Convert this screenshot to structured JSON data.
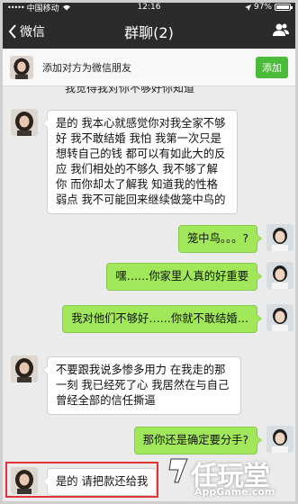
{
  "status_bar": {
    "carrier": "中国移动",
    "time": "12:16",
    "battery": "97%",
    "battery_level": 0.97
  },
  "nav": {
    "back_label": "微信",
    "title": "群聊(2)",
    "right_icon": "person-icon"
  },
  "banner": {
    "text": "添加对方为微信朋友",
    "button": "添加"
  },
  "partial_line": "我觉得我对你不够好你知道",
  "messages": [
    {
      "side": "left",
      "text": "是的 我本心就感觉你对我全家不够好 我不敢结婚 我怕 我第一次只是想转自己的钱 都可以有如此大的反应 我们相处的不够久 我不够了解你  而你却太了解我 知道我的性格弱点 我不可能回来继续做笼中鸟的"
    },
    {
      "side": "right",
      "text": "笼中鸟。。。?"
    },
    {
      "side": "right",
      "text": "嘿……你家里人真的好重要"
    },
    {
      "side": "right",
      "text": "我对他们不够好……你就不敢结婚…"
    },
    {
      "side": "left",
      "text": "不要跟我说多惨多用力 在我走的那一刻 我已经死了心  我居然在与自己曾经全部的信任撕逼"
    },
    {
      "side": "right",
      "text": "那你还是确定要分手?"
    },
    {
      "side": "left",
      "text": "是的  请把款还给我"
    }
  ],
  "watermark": {
    "main": "任玩堂",
    "sub": "AppGame.com"
  },
  "colors": {
    "header_bg": "#2b2b2b",
    "chat_bg": "#ebebeb",
    "bubble_green": "#a0e759",
    "add_button": "#4cbb3a",
    "highlight_border": "#e0343a"
  }
}
